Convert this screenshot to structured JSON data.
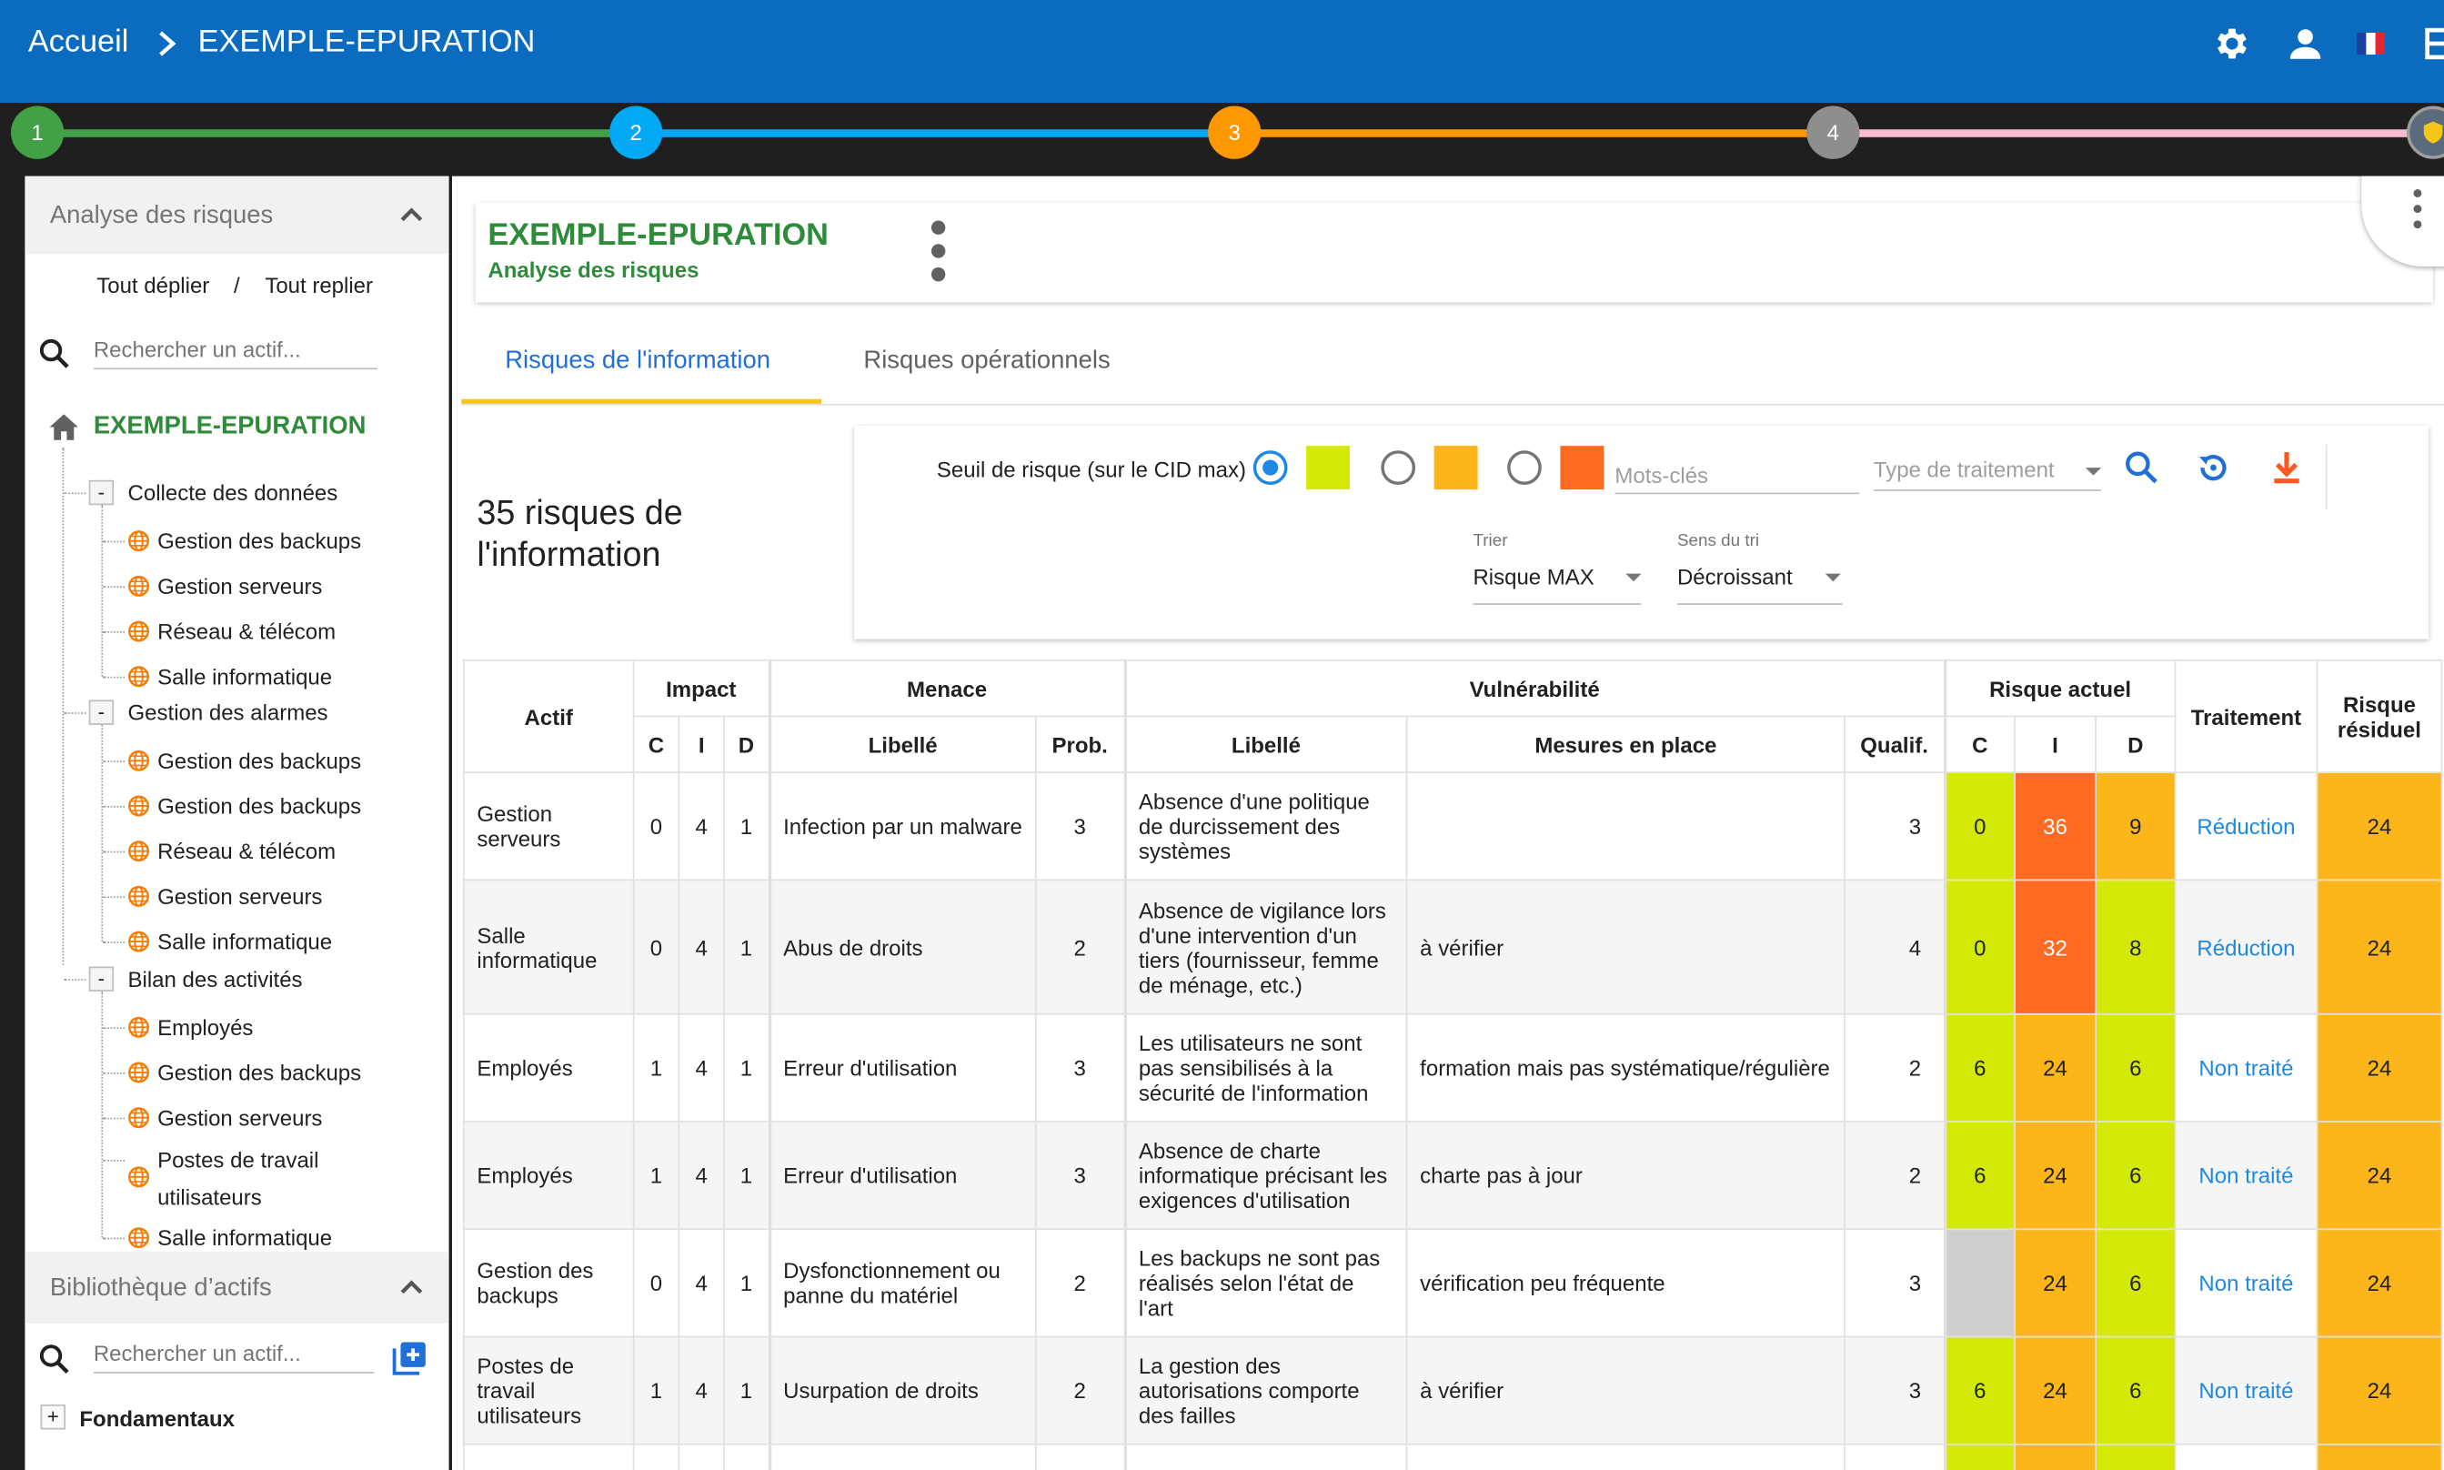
{
  "topbar": {
    "home": "Accueil",
    "title": "EXEMPLE-EPURATION",
    "icons": [
      "gear-icon",
      "user-icon",
      "french-flag-icon",
      "layout-icon"
    ]
  },
  "stepper": {
    "steps": [
      {
        "label": "1",
        "color": "#43a047"
      },
      {
        "label": "2",
        "color": "#03a9f4"
      },
      {
        "label": "3",
        "color": "#ff9800"
      },
      {
        "label": "4",
        "color": "#8e8e8e"
      }
    ],
    "line_colors": [
      "#43a047",
      "#03a9f4",
      "#ff9800",
      "#f8bbd0"
    ]
  },
  "left": {
    "section_title": "Analyse des risques",
    "expand_all": "Tout déplier",
    "link_sep": "/",
    "collapse_all": "Tout replier",
    "search_placeholder": "Rechercher un actif...",
    "root_label": "EXEMPLE-EPURATION",
    "groups": [
      {
        "toggle": "-",
        "label": "Collecte des données",
        "items": [
          "Gestion des backups",
          "Gestion serveurs",
          "Réseau & télécom",
          "Salle informatique"
        ]
      },
      {
        "toggle": "-",
        "label": "Gestion des alarmes",
        "items": [
          "Gestion des backups",
          "Gestion des backups",
          "Réseau & télécom",
          "Gestion serveurs",
          "Salle informatique"
        ]
      },
      {
        "toggle": "-",
        "label": "Bilan des activités",
        "items": [
          "Employés",
          "Gestion des backups",
          "Gestion serveurs",
          "Postes de travail",
          "utilisateurs",
          "Salle informatique"
        ]
      }
    ],
    "library_title": "Bibliothèque d’actifs",
    "library_search_placeholder": "Rechercher un actif...",
    "fundamentals_toggle": "+",
    "fundamentals_label": "Fondamentaux"
  },
  "main": {
    "card_title": "EXEMPLE-EPURATION",
    "card_subtitle": "Analyse des risques",
    "tabs": [
      "Risques de l'information",
      "Risques opérationnels"
    ],
    "count_line1": "35 risques de",
    "count_line2": "l'information",
    "filter": {
      "threshold_label": "Seuil de risque (sur le CID max)",
      "swatch_colors": [
        "#d4ea06",
        "#fcb61a",
        "#ff6b22"
      ],
      "keywords_placeholder": "Mots-clés",
      "treatment_placeholder": "Type de traitement",
      "sort_label": "Trier",
      "sort_value": "Risque MAX",
      "order_label": "Sens du tri",
      "order_value": "Décroissant"
    }
  },
  "colors": {
    "green": "#d4ea06",
    "orange": "#fcb61a",
    "red": "#ff6b22",
    "grey": "#cfcfcf",
    "link": "#1e88e5"
  },
  "table": {
    "groups": {
      "actif": "Actif",
      "impact": "Impact",
      "menace": "Menace",
      "vulnerabilite": "Vulnérabilité",
      "risque_actuel": "Risque actuel",
      "traitement": "Traitement",
      "residuel": "Risque résiduel"
    },
    "sub": {
      "c": "C",
      "i": "I",
      "d": "D",
      "libelle": "Libellé",
      "prob": "Prob.",
      "libelle2": "Libellé",
      "mesures": "Mesures en place",
      "qualif": "Qualif.",
      "rc": "C",
      "ri": "I",
      "rd": "D"
    },
    "rows": [
      {
        "actif": "Gestion serveurs",
        "c": "0",
        "i": "4",
        "d": "1",
        "menace": "Infection par un malware",
        "prob": "3",
        "vuln": "Absence d'une politique de durcissement des systèmes",
        "mesures": "",
        "qualif": "3",
        "rc": "0",
        "ri": "36",
        "rd": "9",
        "rc_color": "#d4ea06",
        "ri_color": "#ff6b22",
        "rd_color": "#fcb61a",
        "traitement": "Réduction",
        "residuel": "24"
      },
      {
        "actif": "Salle informatique",
        "c": "0",
        "i": "4",
        "d": "1",
        "menace": "Abus de droits",
        "prob": "2",
        "vuln": "Absence de vigilance lors d'une intervention d'un tiers (fournisseur, femme de ménage, etc.)",
        "mesures": "à vérifier",
        "qualif": "4",
        "rc": "0",
        "ri": "32",
        "rd": "8",
        "rc_color": "#d4ea06",
        "ri_color": "#ff6b22",
        "rd_color": "#d4ea06",
        "traitement": "Réduction",
        "residuel": "24"
      },
      {
        "actif": "Employés",
        "c": "1",
        "i": "4",
        "d": "1",
        "menace": "Erreur d'utilisation",
        "prob": "3",
        "vuln": "Les utilisateurs ne sont pas sensibilisés à la sécurité de l'information",
        "mesures": "formation mais pas systématique/régulière",
        "qualif": "2",
        "rc": "6",
        "ri": "24",
        "rd": "6",
        "rc_color": "#d4ea06",
        "ri_color": "#fcb61a",
        "rd_color": "#d4ea06",
        "traitement": "Non traité",
        "residuel": "24"
      },
      {
        "actif": "Employés",
        "c": "1",
        "i": "4",
        "d": "1",
        "menace": "Erreur d'utilisation",
        "prob": "3",
        "vuln": "Absence de charte informatique précisant les exigences d'utilisation",
        "mesures": "charte pas à jour",
        "qualif": "2",
        "rc": "6",
        "ri": "24",
        "rd": "6",
        "rc_color": "#d4ea06",
        "ri_color": "#fcb61a",
        "rd_color": "#d4ea06",
        "traitement": "Non traité",
        "residuel": "24"
      },
      {
        "actif": "Gestion des backups",
        "c": "0",
        "i": "4",
        "d": "1",
        "menace": "Dysfonctionnement ou panne du matériel",
        "prob": "2",
        "vuln": "Les backups ne sont pas réalisés selon l'état de l'art",
        "mesures": "vérification peu fréquente",
        "qualif": "3",
        "rc": "",
        "ri": "24",
        "rd": "6",
        "rc_color": "#cfcfcf",
        "ri_color": "#fcb61a",
        "rd_color": "#d4ea06",
        "traitement": "Non traité",
        "residuel": "24"
      },
      {
        "actif": "Postes de travail utilisateurs",
        "c": "1",
        "i": "4",
        "d": "1",
        "menace": "Usurpation de droits",
        "prob": "2",
        "vuln": "La gestion des autorisations comporte des failles",
        "mesures": "à vérifier",
        "qualif": "3",
        "rc": "6",
        "ri": "24",
        "rd": "6",
        "rc_color": "#d4ea06",
        "ri_color": "#fcb61a",
        "rd_color": "#d4ea06",
        "traitement": "Non traité",
        "residuel": "24"
      }
    ]
  }
}
